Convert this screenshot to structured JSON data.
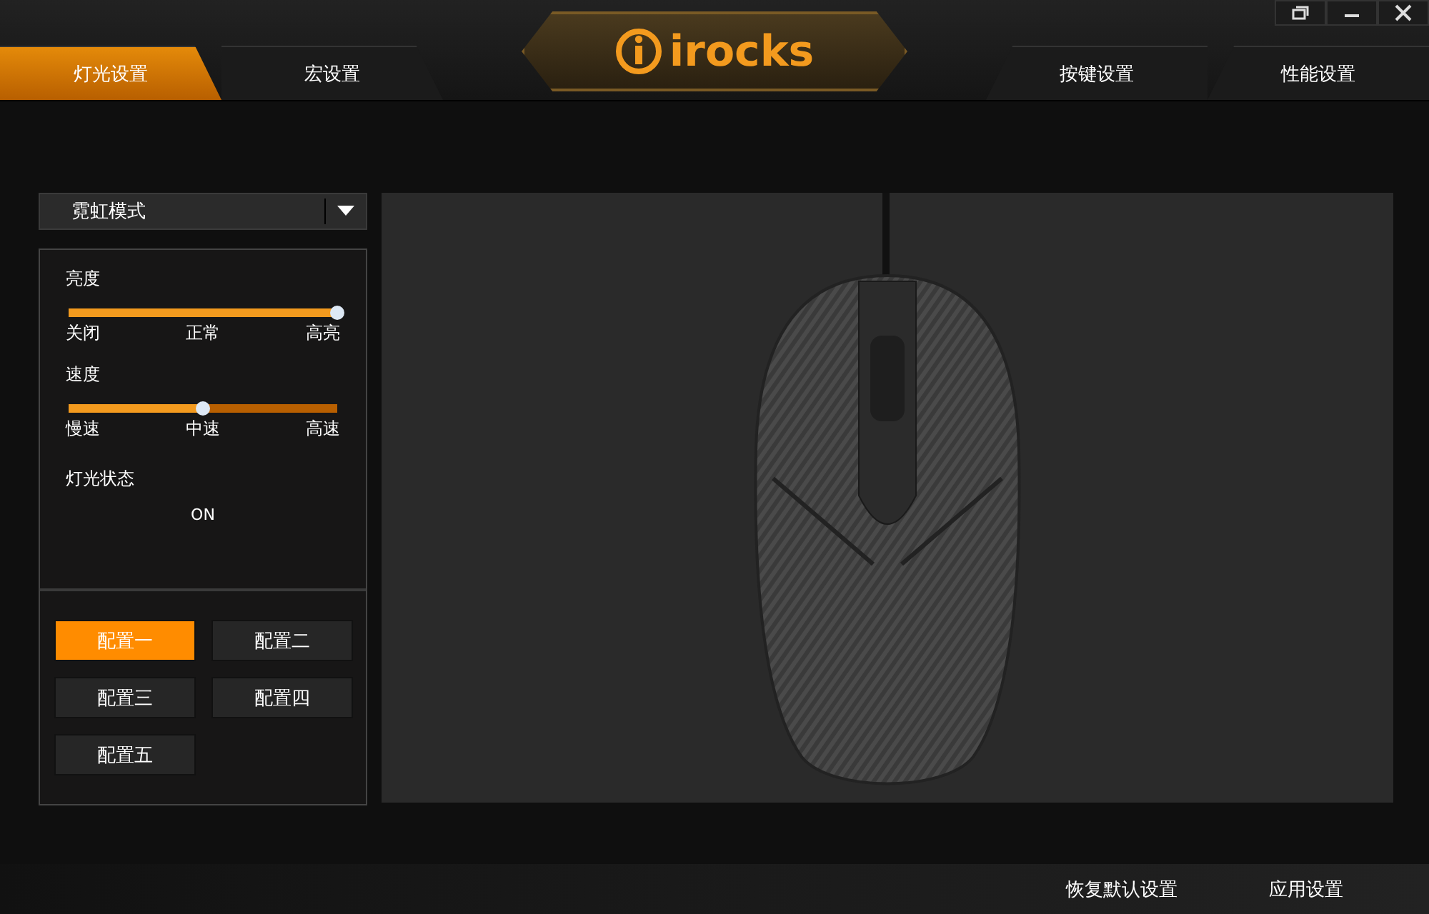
{
  "window": {
    "logo": "irocks"
  },
  "left_tabs": [
    {
      "label": "灯光设置",
      "selected": true
    },
    {
      "label": "宏设置",
      "selected": false
    }
  ],
  "right_tabs": [
    {
      "label": "按键设置",
      "selected": false
    },
    {
      "label": "性能设置",
      "selected": false
    }
  ],
  "mode_dropdown": {
    "value": "霓虹模式"
  },
  "sliders": [
    {
      "title": "亮度",
      "level": 1.0,
      "marks": [
        "关闭",
        "正常",
        "高亮"
      ]
    },
    {
      "title": "速度",
      "level": 0.5,
      "marks": [
        "慢速",
        "中速",
        "高速"
      ]
    }
  ],
  "light_status": {
    "label": "灯光状态",
    "value": "ON"
  },
  "profiles": [
    {
      "label": "配置一",
      "selected": true
    },
    {
      "label": "配置二",
      "selected": false
    },
    {
      "label": "配置三",
      "selected": false
    },
    {
      "label": "配置四",
      "selected": false
    },
    {
      "label": "配置五",
      "selected": false
    }
  ],
  "footer_buttons": [
    "恢复默认设置",
    "应用设置"
  ]
}
